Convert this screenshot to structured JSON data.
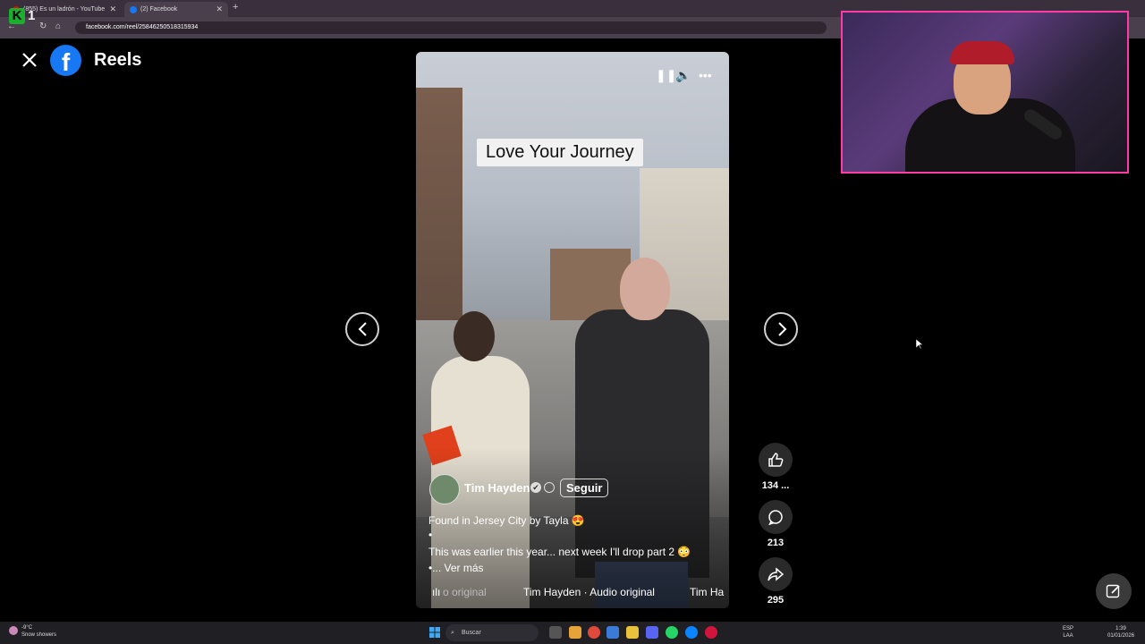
{
  "browser": {
    "tabs": [
      {
        "label": "(855) Es un ladrón - YouTube",
        "close": "✕"
      },
      {
        "label": "(2) Facebook",
        "close": "✕"
      }
    ],
    "new_tab": "+",
    "url": "facebook.com/reel/2584625051831593​4"
  },
  "overlay_badge": {
    "k": "K",
    "num": "1"
  },
  "page": {
    "brand_letter": "f",
    "title": "Reels"
  },
  "reel": {
    "overlay_text": "Love Your Journey",
    "author": "Tim Hayden",
    "follow_label": "Seguir",
    "caption_line1": "Found in Jersey City by Tayla 😍",
    "caption_line2": "•",
    "caption_line3": "This was earlier this year... next week I'll drop part 2 😳",
    "caption_line4": "•... Ver más",
    "audio_parts": [
      "o original",
      "Tim Hayden · Audio original",
      "Tim Ha"
    ]
  },
  "actions": {
    "likes": "134 ...",
    "comments": "213",
    "shares": "295"
  },
  "taskbar": {
    "weather_temp": "-9°C",
    "weather_desc": "Snow showers",
    "search_placeholder": "Buscar",
    "lang_1": "ESP",
    "lang_2": "LAA",
    "time": "1:39",
    "date": "01/01/2026"
  },
  "colors": {
    "facebook_blue": "#1877f2",
    "webcam_border": "#ff3ca6",
    "background": "#000000"
  }
}
